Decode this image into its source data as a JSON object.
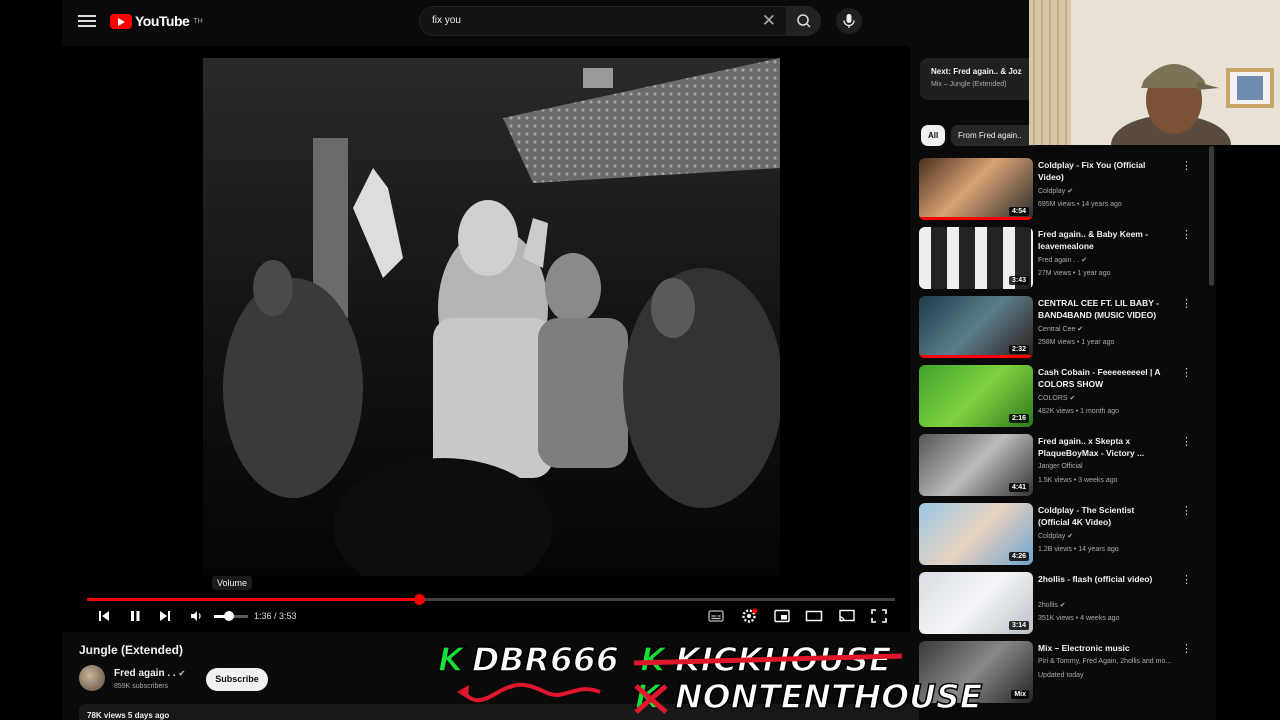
{
  "header": {
    "logo_text": "YouTube",
    "logo_region": "TH",
    "search_value": "fix you"
  },
  "player": {
    "tooltip": "Volume",
    "time": "1:36 / 3:53",
    "progress_fraction": 0.411,
    "volume_fraction": 0.45,
    "accent": "#ff0000"
  },
  "video": {
    "title": "Jungle (Extended)",
    "channel": "Fred again . .",
    "subscribers": "859K subscribers",
    "subscribe_label": "Subscribe",
    "views": "78K views  5 days ago"
  },
  "up_next": {
    "title": "Next: Fred again.. & Joz",
    "subtitle": "Mix – Jungle (Extended)"
  },
  "chips": [
    "All",
    "From Fred again.."
  ],
  "recommendations": [
    {
      "title": "Coldplay - Fix You (Official Video)",
      "channel": "Coldplay",
      "verified": true,
      "meta": "695M views • 14 years ago",
      "duration": "4:54",
      "watched_fraction": 1.0
    },
    {
      "title": "Fred again.. & Baby Keem - leavemealone",
      "channel": "Fred again . .",
      "verified": true,
      "meta": "27M views • 1 year ago",
      "duration": "3:43",
      "watched_fraction": 0
    },
    {
      "title": "CENTRAL CEE FT. LIL BABY - BAND4BAND (MUSIC VIDEO)",
      "channel": "Central Cee",
      "verified": true,
      "meta": "258M views • 1 year ago",
      "duration": "2:32",
      "watched_fraction": 1.0
    },
    {
      "title": "Cash Cobain - Feeeeeeeeel | A COLORS SHOW",
      "channel": "COLORS",
      "verified": true,
      "meta": "482K views • 1 month ago",
      "duration": "2:16",
      "watched_fraction": 0
    },
    {
      "title": "Fred again.. x Skepta x PlaqueBoyMax - Victory ...",
      "channel": "Janger Official",
      "verified": false,
      "meta": "1.5K views • 3 weeks ago",
      "duration": "4:41",
      "watched_fraction": 0
    },
    {
      "title": "Coldplay - The Scientist (Official 4K Video)",
      "channel": "Coldplay",
      "verified": true,
      "meta": "1.2B views • 14 years ago",
      "duration": "4:26",
      "watched_fraction": 0
    },
    {
      "title": "2hollis - flash (official video)",
      "channel": "2hollis",
      "verified": true,
      "meta": "351K views • 4 weeks ago",
      "duration": "3:14",
      "watched_fraction": 0
    },
    {
      "title": "Mix – Electronic music",
      "channel": "Piri & Tommy, Fred Again, 2hollis and mo...",
      "verified": false,
      "meta": "Updated today",
      "duration": "Mix",
      "watched_fraction": 0
    }
  ],
  "overlay": {
    "line1_k": "K",
    "line1": "DBR666",
    "line1_struck_k": "K",
    "line1_struck": "KICKHOUSE",
    "line2_x": "K",
    "line2": "NONTENTHOUSE"
  }
}
